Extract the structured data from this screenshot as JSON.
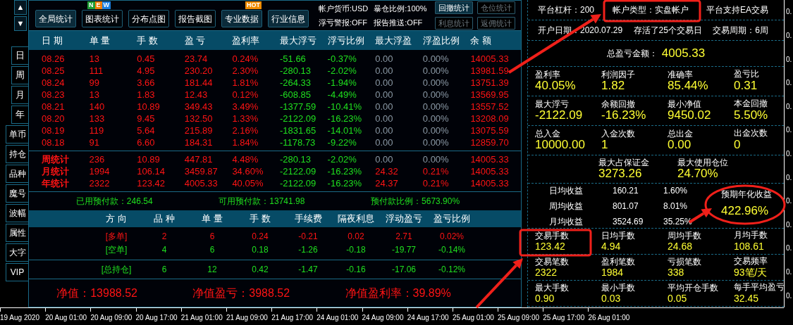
{
  "scroll_buttons": [
    "▲",
    "▼"
  ],
  "period_tabs": [
    "日",
    "周",
    "月",
    "年"
  ],
  "side_tabs": [
    "单币",
    "持仓",
    "品种",
    "魔号",
    "波幅",
    "属性",
    "大字",
    "VIP"
  ],
  "toolbar": {
    "buttons": [
      {
        "label": "全局统计",
        "highlighted": true
      },
      {
        "label": "图表统计",
        "highlighted": false,
        "badge": [
          {
            "text": "N",
            "color": "#1f9e35"
          },
          {
            "text": "E",
            "color": "#f07d00"
          },
          {
            "text": "W",
            "color": "#1a7fe0"
          }
        ]
      },
      {
        "label": "分布点图",
        "highlighted": false
      },
      {
        "label": "报告截图",
        "highlighted": false
      },
      {
        "label": "专业数据",
        "highlighted": true,
        "badge": [
          {
            "text": "HOT",
            "color": "#f08c00"
          }
        ]
      },
      {
        "label": "行业信息",
        "highlighted": true
      }
    ],
    "account_info": [
      "帐户货币:USD",
      "暴仓比例:100%",
      "浮亏警报:OFF",
      "报告推送:OFF"
    ],
    "stat_buttons": [
      {
        "label": "回撤统计",
        "disabled": false
      },
      {
        "label": "仓位统计",
        "disabled": true
      },
      {
        "label": "利息统计",
        "disabled": true
      },
      {
        "label": "返佣统计",
        "disabled": true
      }
    ]
  },
  "daily_table": {
    "columns": [
      "日 期",
      "单 量",
      "手 数",
      "盈 亏",
      "盈利率",
      "最大浮亏",
      "浮亏比例",
      "最大浮盈",
      "浮盈比例",
      "余 额"
    ],
    "rows": [
      {
        "cells": [
          {
            "text": "08.26",
            "color": "#ff1414"
          },
          {
            "text": "13",
            "color": "#ff1414"
          },
          {
            "text": "0.45",
            "color": "#ff1414"
          },
          {
            "text": "23.74",
            "color": "#ff1414"
          },
          {
            "text": "0.24%",
            "color": "#ff1414"
          },
          {
            "text": "-51.66",
            "color": "#1fe01f"
          },
          {
            "text": "-0.37%",
            "color": "#1fe01f"
          },
          {
            "text": "0.00",
            "color": "#8b9aa6"
          },
          {
            "text": "0.00%",
            "color": "#8b9aa6"
          },
          {
            "text": "14005.33",
            "color": "#ff1414"
          }
        ]
      },
      {
        "cells": [
          {
            "text": "08.25",
            "color": "#ff1414"
          },
          {
            "text": "111",
            "color": "#ff1414"
          },
          {
            "text": "4.95",
            "color": "#ff1414"
          },
          {
            "text": "230.20",
            "color": "#ff1414"
          },
          {
            "text": "2.30%",
            "color": "#ff1414"
          },
          {
            "text": "-280.13",
            "color": "#1fe01f"
          },
          {
            "text": "-2.02%",
            "color": "#1fe01f"
          },
          {
            "text": "0.00",
            "color": "#8b9aa6"
          },
          {
            "text": "0.00%",
            "color": "#8b9aa6"
          },
          {
            "text": "13981.59",
            "color": "#ff1414"
          }
        ]
      },
      {
        "cells": [
          {
            "text": "08.24",
            "color": "#ff1414"
          },
          {
            "text": "99",
            "color": "#ff1414"
          },
          {
            "text": "3.66",
            "color": "#ff1414"
          },
          {
            "text": "181.44",
            "color": "#ff1414"
          },
          {
            "text": "1.81%",
            "color": "#ff1414"
          },
          {
            "text": "-264.33",
            "color": "#1fe01f"
          },
          {
            "text": "-1.94%",
            "color": "#1fe01f"
          },
          {
            "text": "0.00",
            "color": "#8b9aa6"
          },
          {
            "text": "0.00%",
            "color": "#8b9aa6"
          },
          {
            "text": "13751.39",
            "color": "#ff1414"
          }
        ]
      },
      {
        "cells": [
          {
            "text": "08.23",
            "color": "#ff1414"
          },
          {
            "text": "13",
            "color": "#ff1414"
          },
          {
            "text": "1.83",
            "color": "#ff1414"
          },
          {
            "text": "12.43",
            "color": "#ff1414"
          },
          {
            "text": "0.12%",
            "color": "#ff1414"
          },
          {
            "text": "-608.85",
            "color": "#1fe01f"
          },
          {
            "text": "-4.49%",
            "color": "#1fe01f"
          },
          {
            "text": "0.00",
            "color": "#8b9aa6"
          },
          {
            "text": "0.00%",
            "color": "#8b9aa6"
          },
          {
            "text": "13569.95",
            "color": "#ff1414"
          }
        ]
      },
      {
        "cells": [
          {
            "text": "08.21",
            "color": "#ff1414"
          },
          {
            "text": "140",
            "color": "#ff1414"
          },
          {
            "text": "10.89",
            "color": "#ff1414"
          },
          {
            "text": "349.43",
            "color": "#ff1414"
          },
          {
            "text": "3.49%",
            "color": "#ff1414"
          },
          {
            "text": "-1377.59",
            "color": "#1fe01f"
          },
          {
            "text": "-10.41%",
            "color": "#1fe01f"
          },
          {
            "text": "0.00",
            "color": "#8b9aa6"
          },
          {
            "text": "0.00%",
            "color": "#8b9aa6"
          },
          {
            "text": "13557.52",
            "color": "#ff1414"
          }
        ]
      },
      {
        "cells": [
          {
            "text": "08.20",
            "color": "#ff1414"
          },
          {
            "text": "133",
            "color": "#ff1414"
          },
          {
            "text": "9.45",
            "color": "#ff1414"
          },
          {
            "text": "132.50",
            "color": "#ff1414"
          },
          {
            "text": "1.33%",
            "color": "#ff1414"
          },
          {
            "text": "-2122.09",
            "color": "#1fe01f"
          },
          {
            "text": "-16.23%",
            "color": "#1fe01f"
          },
          {
            "text": "0.00",
            "color": "#8b9aa6"
          },
          {
            "text": "0.00%",
            "color": "#8b9aa6"
          },
          {
            "text": "13208.09",
            "color": "#ff1414"
          }
        ]
      },
      {
        "cells": [
          {
            "text": "08.19",
            "color": "#ff1414"
          },
          {
            "text": "119",
            "color": "#ff1414"
          },
          {
            "text": "5.64",
            "color": "#ff1414"
          },
          {
            "text": "215.89",
            "color": "#ff1414"
          },
          {
            "text": "2.16%",
            "color": "#ff1414"
          },
          {
            "text": "-1831.65",
            "color": "#1fe01f"
          },
          {
            "text": "-14.01%",
            "color": "#1fe01f"
          },
          {
            "text": "0.00",
            "color": "#8b9aa6"
          },
          {
            "text": "0.00%",
            "color": "#8b9aa6"
          },
          {
            "text": "13075.59",
            "color": "#ff1414"
          }
        ]
      },
      {
        "cells": [
          {
            "text": "08.18",
            "color": "#ff1414"
          },
          {
            "text": "91",
            "color": "#ff1414"
          },
          {
            "text": "6.60",
            "color": "#ff1414"
          },
          {
            "text": "184.31",
            "color": "#ff1414"
          },
          {
            "text": "1.84%",
            "color": "#ff1414"
          },
          {
            "text": "-1178.73",
            "color": "#1fe01f"
          },
          {
            "text": "-9.22%",
            "color": "#1fe01f"
          },
          {
            "text": "0.00",
            "color": "#8b9aa6"
          },
          {
            "text": "0.00%",
            "color": "#8b9aa6"
          },
          {
            "text": "12859.70",
            "color": "#ff1414"
          }
        ]
      }
    ],
    "summary_rows": [
      {
        "cells": [
          {
            "text": "周统计",
            "color": "#ff1414"
          },
          {
            "text": "236",
            "color": "#ff1414"
          },
          {
            "text": "10.89",
            "color": "#ff1414"
          },
          {
            "text": "447.81",
            "color": "#ff1414"
          },
          {
            "text": "4.48%",
            "color": "#ff1414"
          },
          {
            "text": "-280.13",
            "color": "#1fe01f"
          },
          {
            "text": "-2.02%",
            "color": "#1fe01f"
          },
          {
            "text": "0.00",
            "color": "#8b9aa6"
          },
          {
            "text": "0.00%",
            "color": "#8b9aa6"
          },
          {
            "text": "14005.33",
            "color": "#ff1414"
          }
        ]
      },
      {
        "cells": [
          {
            "text": "月统计",
            "color": "#ff1414"
          },
          {
            "text": "1994",
            "color": "#ff1414"
          },
          {
            "text": "106.14",
            "color": "#ff1414"
          },
          {
            "text": "3459.87",
            "color": "#ff1414"
          },
          {
            "text": "34.60%",
            "color": "#ff1414"
          },
          {
            "text": "-2122.09",
            "color": "#1fe01f"
          },
          {
            "text": "-16.23%",
            "color": "#1fe01f"
          },
          {
            "text": "24.32",
            "color": "#ff1414"
          },
          {
            "text": "0.21%",
            "color": "#ff1414"
          },
          {
            "text": "14005.33",
            "color": "#ff1414"
          }
        ]
      },
      {
        "cells": [
          {
            "text": "年统计",
            "color": "#ff1414"
          },
          {
            "text": "2322",
            "color": "#ff1414"
          },
          {
            "text": "123.42",
            "color": "#ff1414"
          },
          {
            "text": "4005.33",
            "color": "#ff1414"
          },
          {
            "text": "40.05%",
            "color": "#ff1414"
          },
          {
            "text": "-2122.09",
            "color": "#1fe01f"
          },
          {
            "text": "-16.23%",
            "color": "#1fe01f"
          },
          {
            "text": "24.37",
            "color": "#ff1414"
          },
          {
            "text": "0.21%",
            "color": "#ff1414"
          },
          {
            "text": "14005.33",
            "color": "#ff1414"
          }
        ]
      }
    ]
  },
  "prepayment": [
    "已用预付款：246.54",
    "可用预付款：13741.98",
    "预付款比例：5673.90%"
  ],
  "positions_table": {
    "columns": [
      "方 向",
      "品 种",
      "单 量",
      "手 数",
      "手续费",
      "隔夜利息",
      "浮动盈亏",
      "盈亏比例"
    ],
    "rows": [
      {
        "color": "#ff1414",
        "cells": [
          "[多单]",
          "2",
          "6",
          "0.24",
          "-0.21",
          "0.02",
          "2.71",
          "0.02%"
        ]
      },
      {
        "color": "#1fe01f",
        "cells": [
          "[空单]",
          "4",
          "6",
          "0.18",
          "-1.26",
          "-0.18",
          "-19.77",
          "-0.14%"
        ]
      }
    ],
    "total": {
      "color": "#1fe01f",
      "cells": [
        "[总持仓]",
        "6",
        "12",
        "0.42",
        "-1.47",
        "-0.16",
        "-17.06",
        "-0.12%"
      ]
    }
  },
  "equity_line": [
    "净值：13988.52",
    "净值盈亏：3988.52",
    "净值盈利率：39.89%"
  ],
  "account_panel": [
    {
      "kind": "info",
      "items": [
        "平台杠杆：200",
        "帐户类型：实盘帐户",
        "平台支持EA交易"
      ]
    },
    {
      "kind": "info",
      "items": [
        "开户日期：2020.07.29",
        "存活了25个交易日",
        "交易周期：6周"
      ]
    },
    {
      "kind": "total",
      "label": "总盈亏金额：",
      "value": "4005.33"
    },
    {
      "kind": "stats",
      "items": [
        {
          "label": "盈利率",
          "value": "40.05%"
        },
        {
          "label": "利润因子",
          "value": "1.82"
        },
        {
          "label": "准确率",
          "value": "85.44%"
        },
        {
          "label": "盈亏比",
          "value": "0.31"
        }
      ]
    },
    {
      "kind": "stats",
      "items": [
        {
          "label": "最大浮亏",
          "value": "-2122.09"
        },
        {
          "label": "余额回撤",
          "value": "-16.23%"
        },
        {
          "label": "最小净值",
          "value": "9450.02"
        },
        {
          "label": "本金回撤",
          "value": "5.50%"
        }
      ]
    },
    {
      "kind": "stats",
      "items": [
        {
          "label": "总入金",
          "value": "10000.00"
        },
        {
          "label": "入金次数",
          "value": "1"
        },
        {
          "label": "总出金",
          "value": "0.00"
        },
        {
          "label": "出金次数",
          "value": "0"
        }
      ]
    },
    {
      "kind": "pair",
      "items": [
        {
          "label": "最大占保证金",
          "value": "3273.26"
        },
        {
          "label": "最大使用仓位",
          "value": "24.70%"
        }
      ]
    },
    {
      "kind": "averages",
      "rows": [
        {
          "label": "日均收益",
          "amount": "160.21",
          "rate": "1.60%"
        },
        {
          "label": "周均收益",
          "amount": "801.07",
          "rate": "8.01%"
        },
        {
          "label": "月均收益",
          "amount": "3524.69",
          "rate": "35.25%"
        }
      ],
      "highlight": {
        "label": "预期年化收益",
        "value": "422.96%"
      }
    },
    {
      "kind": "stats_small",
      "items": [
        {
          "label": "交易手数",
          "value": "123.42"
        },
        {
          "label": "日均手数",
          "value": "4.94"
        },
        {
          "label": "周均手数",
          "value": "24.68"
        },
        {
          "label": "月均手数",
          "value": "108.61"
        }
      ]
    },
    {
      "kind": "stats_small",
      "items": [
        {
          "label": "交易笔数",
          "value": "2322"
        },
        {
          "label": "盈利笔数",
          "value": "1984"
        },
        {
          "label": "亏损笔数",
          "value": "338"
        },
        {
          "label": "交易频率",
          "value": "93笔/天"
        }
      ]
    },
    {
      "kind": "stats_small",
      "items": [
        {
          "label": "最大手数",
          "value": "0.90"
        },
        {
          "label": "最小手数",
          "value": "0.03"
        },
        {
          "label": "平均开仓手数",
          "value": "0.05"
        },
        {
          "label": "每手平均盈亏",
          "value": "32.45"
        }
      ]
    }
  ],
  "price_axis": [
    "0.",
    "0.",
    "0.",
    "0.",
    "0.",
    "0.",
    "0.",
    "0.",
    "0.",
    "0.",
    "0.",
    "0.",
    "0."
  ],
  "time_axis": [
    "19 Aug 2020",
    "20 Aug 01:00",
    "20 Aug 09:00",
    "20 Aug 17:00",
    "21 Aug 01:00",
    "21 Aug 09:00",
    "21 Aug 17:00",
    "24 Aug 01:00",
    "24 Aug 09:00",
    "24 Aug 17:00",
    "25 Aug 01:00",
    "25 Aug 09:00",
    "25 Aug 17:00",
    "26 Aug 01:00"
  ],
  "annotations": [
    {
      "kind": "arrow"
    },
    {
      "kind": "box"
    },
    {
      "kind": "arrow"
    },
    {
      "kind": "ellipse"
    },
    {
      "kind": "box"
    },
    {
      "kind": "arrow"
    }
  ]
}
